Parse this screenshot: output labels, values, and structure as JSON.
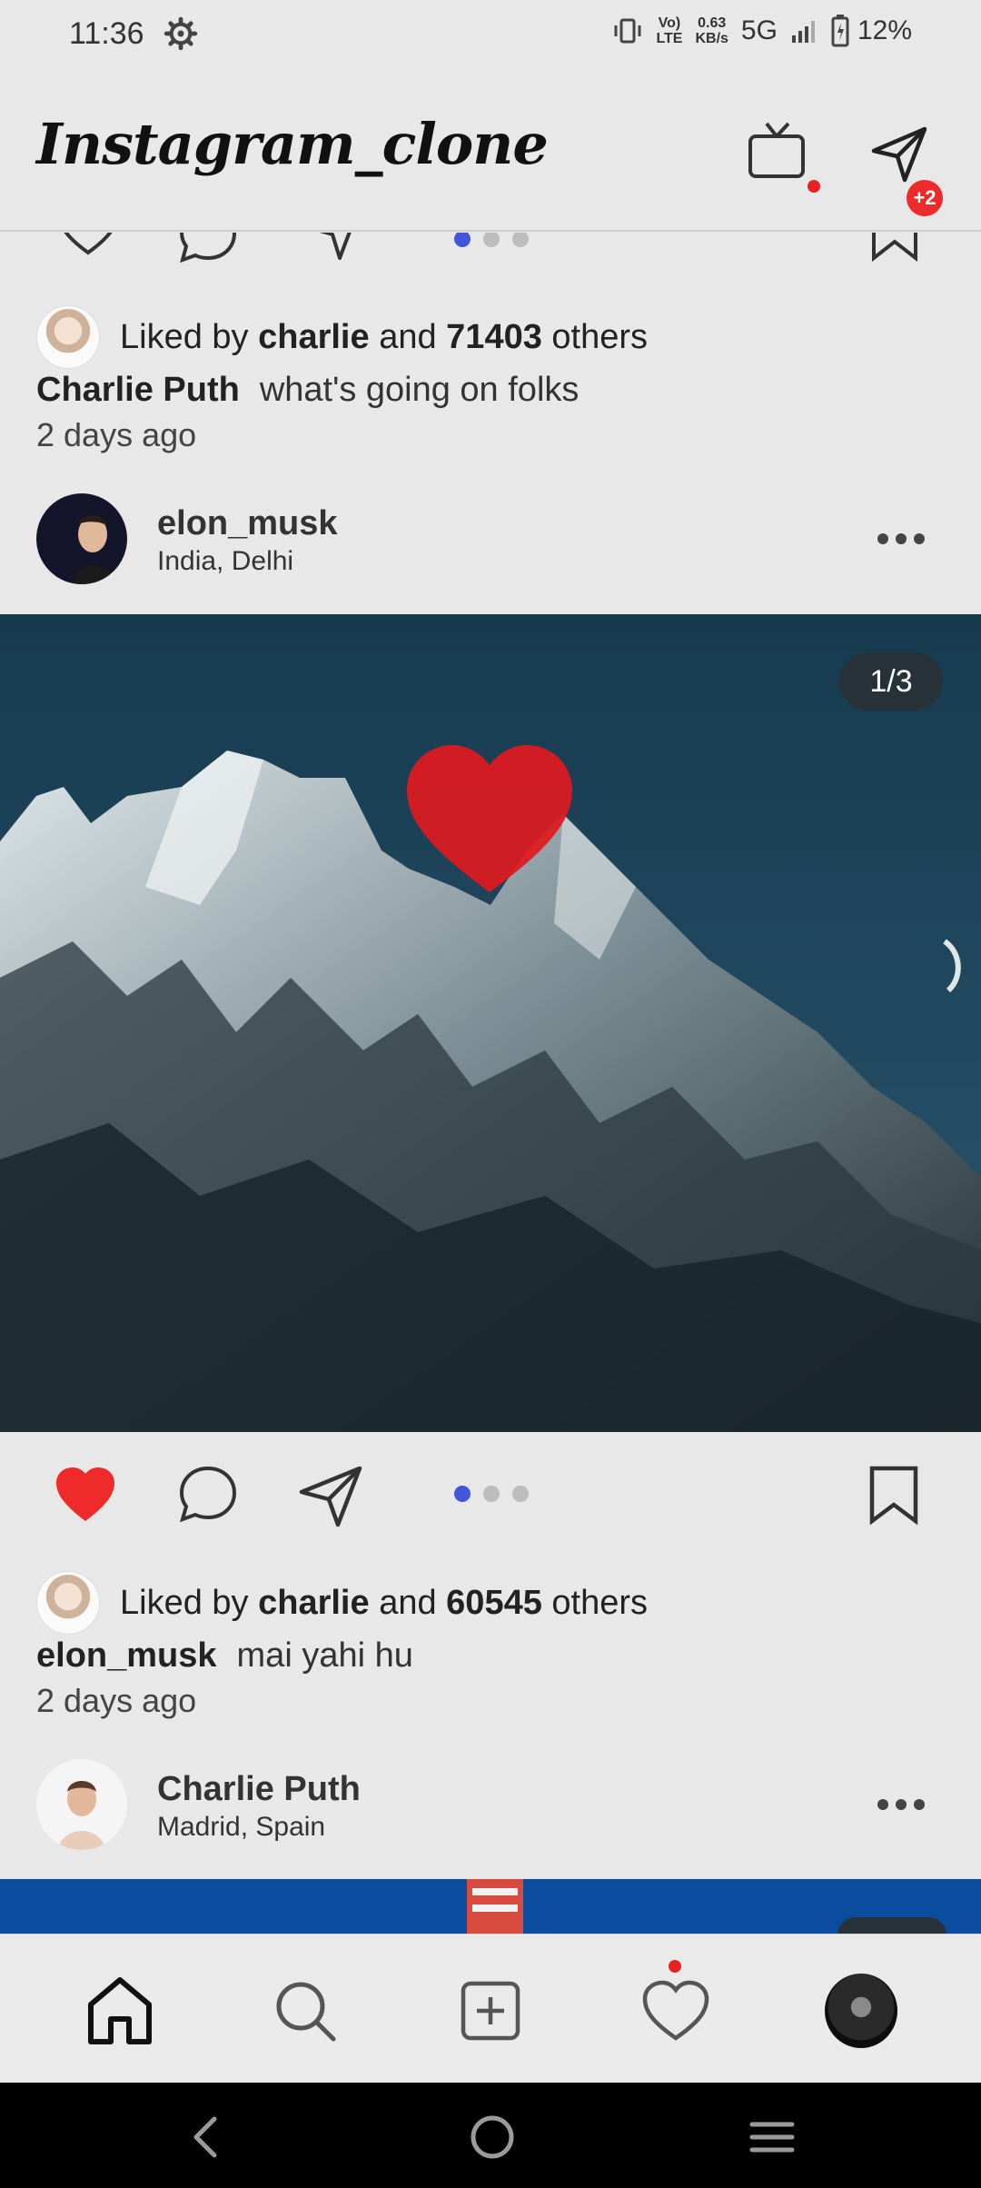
{
  "status_bar": {
    "time": "11:36",
    "network_speed_top": "0.63",
    "network_speed_bottom": "KB/s",
    "volte_top": "Vo)",
    "volte_bottom": "LTE",
    "network_type": "5G",
    "battery": "12%"
  },
  "header": {
    "title": "Instagram_clone",
    "dm_badge": "+2"
  },
  "post1": {
    "likes_prefix": "Liked by",
    "liked_by": "charlie",
    "likes_mid": "and",
    "likes_count": "71403",
    "likes_suffix": "others",
    "caption_user": "Charlie Puth",
    "caption_text": "what's going on folks",
    "time": "2 days ago"
  },
  "post2": {
    "username": "elon_musk",
    "location": "India, Delhi",
    "image_counter": "1/3",
    "liked": true,
    "likes_prefix": "Liked by",
    "liked_by": "charlie",
    "likes_mid": "and",
    "likes_count": "60545",
    "likes_suffix": "others",
    "caption_user": "elon_musk",
    "caption_text": "mai yahi hu",
    "time": "2 days ago"
  },
  "post3": {
    "username": "Charlie Puth",
    "location": "Madrid, Spain"
  },
  "colors": {
    "background": "#e8e8e8",
    "like_red": "#ee2a2a",
    "active_dot": "#4356d9",
    "badge_red": "#ee2a2a"
  },
  "icons": {
    "status": [
      "gear-icon",
      "vibrate-icon",
      "signal-icon",
      "battery-icon"
    ],
    "header": [
      "tv-icon",
      "send-icon"
    ],
    "post_actions": [
      "heart-icon",
      "comment-icon",
      "share-icon",
      "bookmark-icon"
    ],
    "bottom_nav": [
      "home-icon",
      "search-icon",
      "add-post-icon",
      "heart-icon",
      "profile-avatar"
    ]
  }
}
